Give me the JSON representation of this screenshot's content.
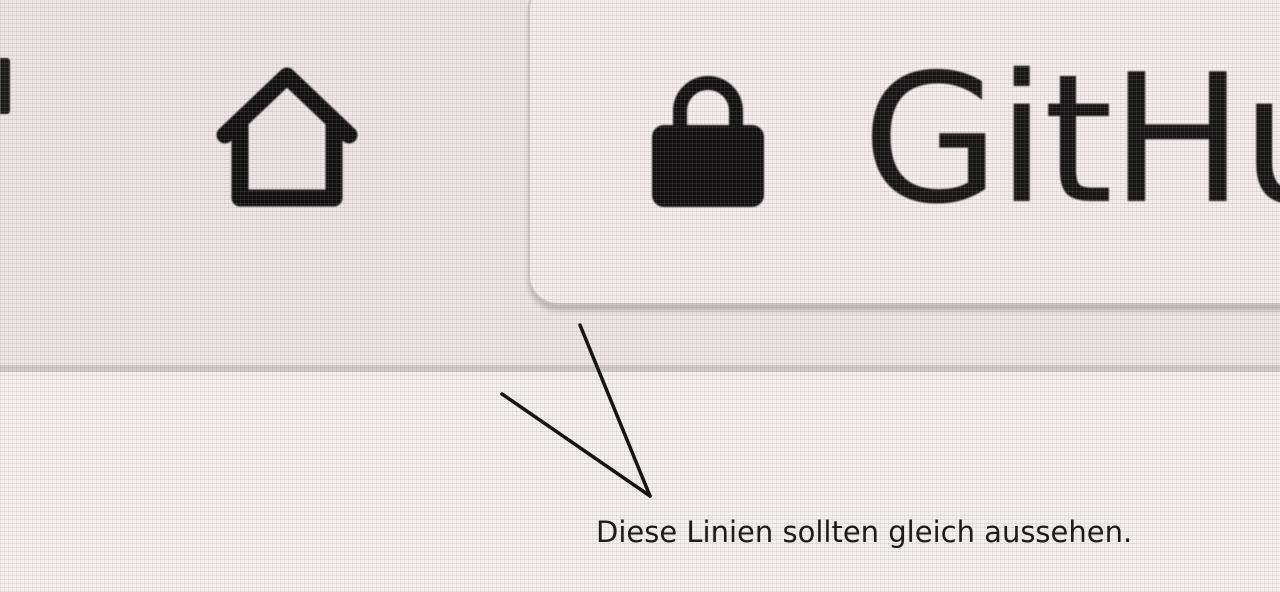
{
  "browser": {
    "toolbar": {
      "home_icon": "home-icon",
      "url_bar": {
        "lock_icon": "lock-icon",
        "url_text": "GitHu"
      }
    }
  },
  "annotation": {
    "text": "Diese Linien sollten gleich aussehen."
  },
  "colors": {
    "toolbar_background": "#ece6e6",
    "content_background": "#f4f1f0",
    "url_bar_background": "#f3eded",
    "ink": "#161414"
  }
}
